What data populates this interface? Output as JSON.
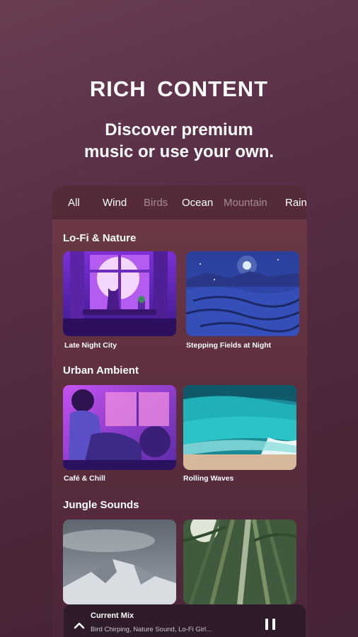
{
  "promo": {
    "headline": "RICH  CONTENT",
    "subline_1": "Discover premium",
    "subline_2": "music or use your own."
  },
  "tabs": [
    {
      "label": "All",
      "active": true
    },
    {
      "label": "Wind",
      "active": true
    },
    {
      "label": "Birds",
      "active": false
    },
    {
      "label": "Ocean",
      "active": true
    },
    {
      "label": "Mountain",
      "active": false
    },
    {
      "label": "Rain",
      "active": true
    }
  ],
  "sections": [
    {
      "title": "Lo-Fi & Nature",
      "cards": [
        {
          "label": "Late Night City",
          "art": "purple-window-cat"
        },
        {
          "label": "Stepping Fields at Night",
          "art": "night-rice-terraces"
        }
      ]
    },
    {
      "title": "Urban Ambient",
      "cards": [
        {
          "label": "Café & Chill",
          "art": "lofi-girl-window"
        },
        {
          "label": "Rolling Waves",
          "art": "turquoise-waves"
        }
      ]
    },
    {
      "title": "Jungle Sounds",
      "cards": [
        {
          "label": "",
          "art": "misty-mountain"
        },
        {
          "label": "",
          "art": "bamboo-forest"
        }
      ]
    }
  ],
  "player": {
    "title": "Current Mix",
    "subtitle": "Bird Chirping, Nature Sound, Lo-Fi Girl...",
    "expand_icon": "chevron-up-icon",
    "control_icon": "pause-icon"
  },
  "colors": {
    "background": "#5a2f48",
    "panel": "#6e3a46",
    "player": "#2e1c2b"
  }
}
